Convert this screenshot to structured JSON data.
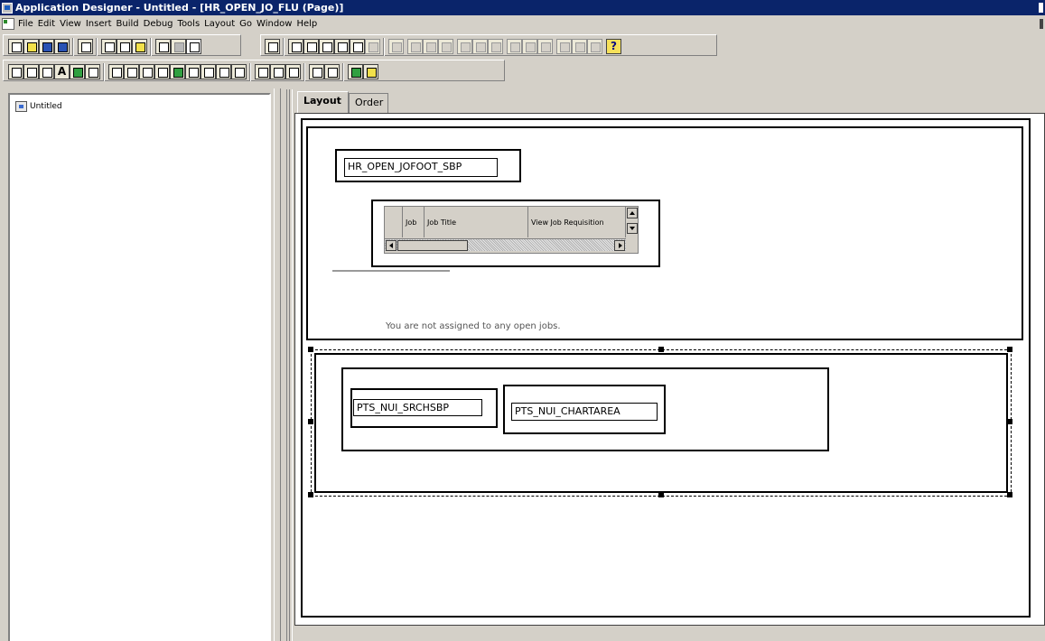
{
  "window": {
    "title": "Application Designer - Untitled - [HR_OPEN_JO_FLU (Page)]"
  },
  "menu": {
    "items": [
      "File",
      "Edit",
      "View",
      "Insert",
      "Build",
      "Debug",
      "Tools",
      "Layout",
      "Go",
      "Window",
      "Help"
    ]
  },
  "project_tree": {
    "root_label": "Untitled"
  },
  "tabs": {
    "layout": "Layout",
    "order": "Order"
  },
  "page": {
    "subpage_top": "HR_OPEN_JOFOOT_SBP",
    "grid": {
      "columns": [
        "",
        "Job",
        "Job Title",
        "View Job Requisition"
      ]
    },
    "message": "You are not assigned to any open jobs.",
    "subpage_search": "PTS_NUI_SRCHSBP",
    "subpage_chart": "PTS_NUI_CHARTAREA"
  },
  "toolbar": {
    "help_icon": "question-mark-icon"
  }
}
